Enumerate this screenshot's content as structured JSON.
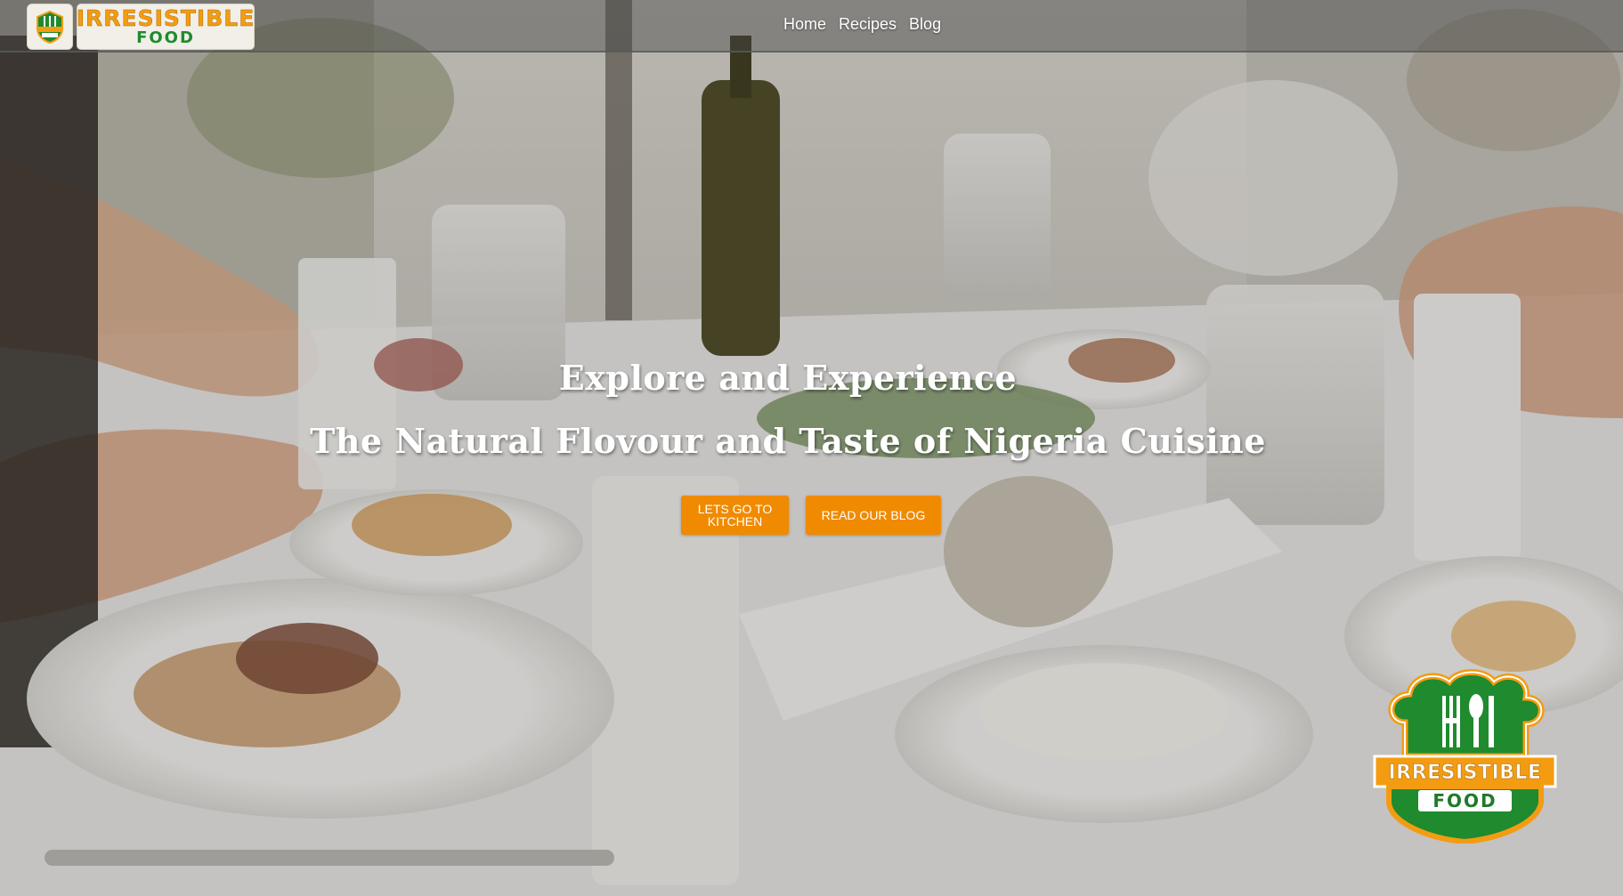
{
  "brand": {
    "name_line1": "IRRESISTIBLE",
    "name_line2": "FOOD",
    "logo_icon": "chef-hat-cutlery-icon",
    "colors": {
      "orange": "#f39c12",
      "green": "#1f8a2e"
    }
  },
  "nav": {
    "items": [
      {
        "label": "Home"
      },
      {
        "label": "Recipes"
      },
      {
        "label": "Blog"
      }
    ]
  },
  "hero": {
    "heading_line1": "Explore and Experience",
    "heading_line2": "The Natural Flovour and Taste of Nigeria Cuisine",
    "background": "dining-table-photo",
    "buttons": {
      "kitchen_label_line1": "LETS GO TO",
      "kitchen_label_line2": "KITCHEN",
      "blog_label": "READ OUR BLOG",
      "color": "#f08a00"
    }
  },
  "corner_logo": {
    "line1": "IRRESISTIBLE",
    "line2": "FOOD",
    "icon": "chef-hat-cutlery-icon"
  }
}
